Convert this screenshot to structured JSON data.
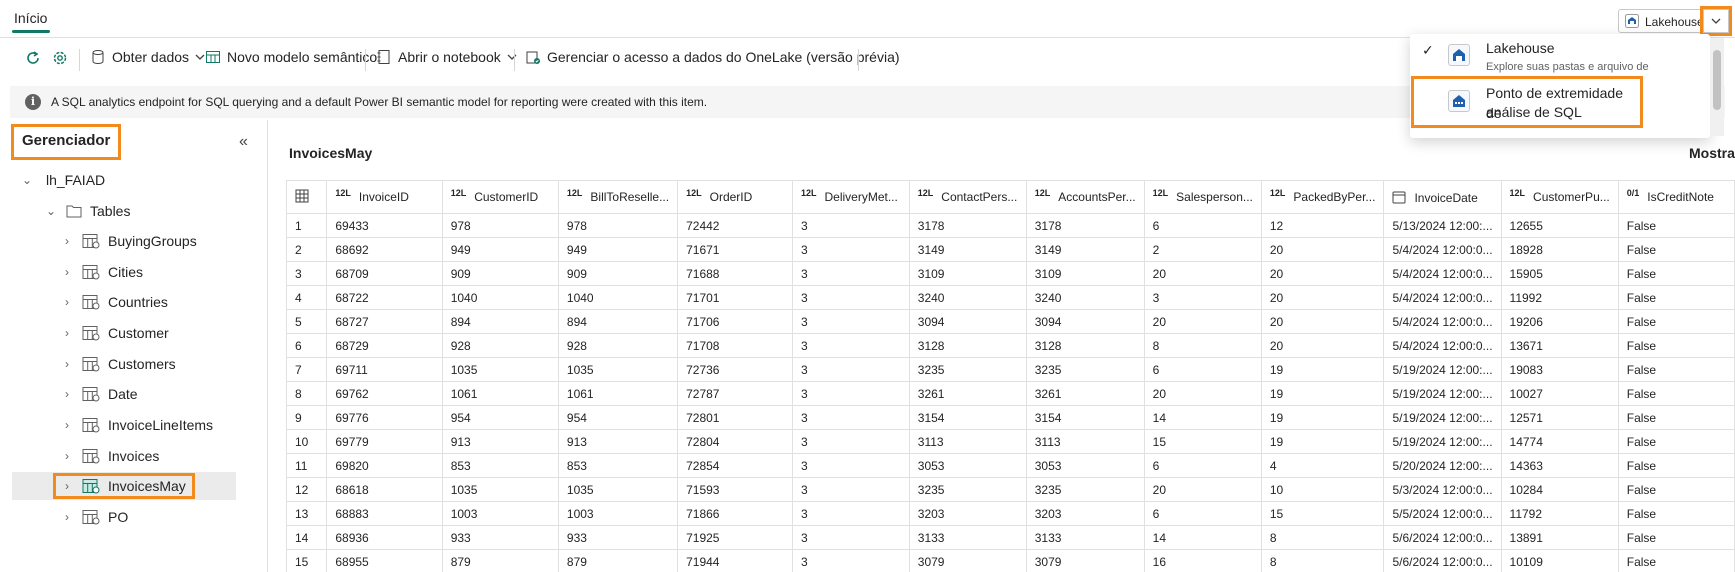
{
  "tabs": {
    "home_label": "Início"
  },
  "mode_switch": {
    "label": "Lakehouse"
  },
  "toolbar": {
    "get_data": "Obter dados",
    "new_semantic_model": "Novo modelo semântico",
    "open_notebook": "Abrir o notebook",
    "manage_access": "Gerenciar o acesso a dados do OneLake (versão prévia)"
  },
  "banner": {
    "text": "A SQL analytics endpoint for SQL querying and a default Power BI semantic model for reporting were created with this item."
  },
  "explorer": {
    "title": "Gerenciador",
    "lakehouse_name": "lh_FAIAD",
    "tables_folder": "Tables",
    "tables": [
      "BuyingGroups",
      "Cities",
      "Countries",
      "Customer",
      "Customers",
      "Date",
      "InvoiceLineItems",
      "Invoices",
      "InvoicesMay",
      "PO"
    ]
  },
  "content": {
    "table_title": "InvoicesMay",
    "right_label": "Mostra"
  },
  "grid": {
    "columns": [
      {
        "type": "12L",
        "name": "InvoiceID"
      },
      {
        "type": "12L",
        "name": "CustomerID"
      },
      {
        "type": "12L",
        "name": "BillToReselle..."
      },
      {
        "type": "12L",
        "name": "OrderID"
      },
      {
        "type": "12L",
        "name": "DeliveryMet..."
      },
      {
        "type": "12L",
        "name": "ContactPers..."
      },
      {
        "type": "12L",
        "name": "AccountsPer..."
      },
      {
        "type": "12L",
        "name": "Salesperson..."
      },
      {
        "type": "12L",
        "name": "PackedByPer..."
      },
      {
        "type": "cal",
        "name": "InvoiceDate"
      },
      {
        "type": "12L",
        "name": "CustomerPu..."
      },
      {
        "type": "0/1",
        "name": "IsCreditNote"
      }
    ],
    "rows": [
      [
        "1",
        "69433",
        "978",
        "978",
        "72442",
        "3",
        "3178",
        "3178",
        "6",
        "12",
        "5/13/2024 12:00:...",
        "12655",
        "False"
      ],
      [
        "2",
        "68692",
        "949",
        "949",
        "71671",
        "3",
        "3149",
        "3149",
        "2",
        "20",
        "5/4/2024 12:00:0...",
        "18928",
        "False"
      ],
      [
        "3",
        "68709",
        "909",
        "909",
        "71688",
        "3",
        "3109",
        "3109",
        "20",
        "20",
        "5/4/2024 12:00:0...",
        "15905",
        "False"
      ],
      [
        "4",
        "68722",
        "1040",
        "1040",
        "71701",
        "3",
        "3240",
        "3240",
        "3",
        "20",
        "5/4/2024 12:00:0...",
        "11992",
        "False"
      ],
      [
        "5",
        "68727",
        "894",
        "894",
        "71706",
        "3",
        "3094",
        "3094",
        "20",
        "20",
        "5/4/2024 12:00:0...",
        "19206",
        "False"
      ],
      [
        "6",
        "68729",
        "928",
        "928",
        "71708",
        "3",
        "3128",
        "3128",
        "8",
        "20",
        "5/4/2024 12:00:0...",
        "13671",
        "False"
      ],
      [
        "7",
        "69711",
        "1035",
        "1035",
        "72736",
        "3",
        "3235",
        "3235",
        "6",
        "19",
        "5/19/2024 12:00:...",
        "19083",
        "False"
      ],
      [
        "8",
        "69762",
        "1061",
        "1061",
        "72787",
        "3",
        "3261",
        "3261",
        "20",
        "19",
        "5/19/2024 12:00:...",
        "10027",
        "False"
      ],
      [
        "9",
        "69776",
        "954",
        "954",
        "72801",
        "3",
        "3154",
        "3154",
        "14",
        "19",
        "5/19/2024 12:00:...",
        "12571",
        "False"
      ],
      [
        "10",
        "69779",
        "913",
        "913",
        "72804",
        "3",
        "3113",
        "3113",
        "15",
        "19",
        "5/19/2024 12:00:...",
        "14774",
        "False"
      ],
      [
        "11",
        "69820",
        "853",
        "853",
        "72854",
        "3",
        "3053",
        "3053",
        "6",
        "4",
        "5/20/2024 12:00:...",
        "14363",
        "False"
      ],
      [
        "12",
        "68618",
        "1035",
        "1035",
        "71593",
        "3",
        "3235",
        "3235",
        "20",
        "10",
        "5/3/2024 12:00:0...",
        "10284",
        "False"
      ],
      [
        "13",
        "68883",
        "1003",
        "1003",
        "71866",
        "3",
        "3203",
        "3203",
        "6",
        "15",
        "5/5/2024 12:00:0...",
        "11792",
        "False"
      ],
      [
        "14",
        "68936",
        "933",
        "933",
        "71925",
        "3",
        "3133",
        "3133",
        "14",
        "8",
        "5/6/2024 12:00:0...",
        "13891",
        "False"
      ],
      [
        "15",
        "68955",
        "879",
        "879",
        "71944",
        "3",
        "3079",
        "3079",
        "16",
        "8",
        "5/6/2024 12:00:0...",
        "10109",
        "False"
      ]
    ]
  },
  "popup": {
    "item1_label": "Lakehouse",
    "item1_sub": "Explore suas pastas e arquivo de",
    "item2_label_line1": "Ponto de extremidade de",
    "item2_label_line2": "análise de SQL"
  },
  "colors": {
    "accent": "#117865",
    "highlight": "#f28a1d",
    "selected_row": "#ebebeb"
  }
}
